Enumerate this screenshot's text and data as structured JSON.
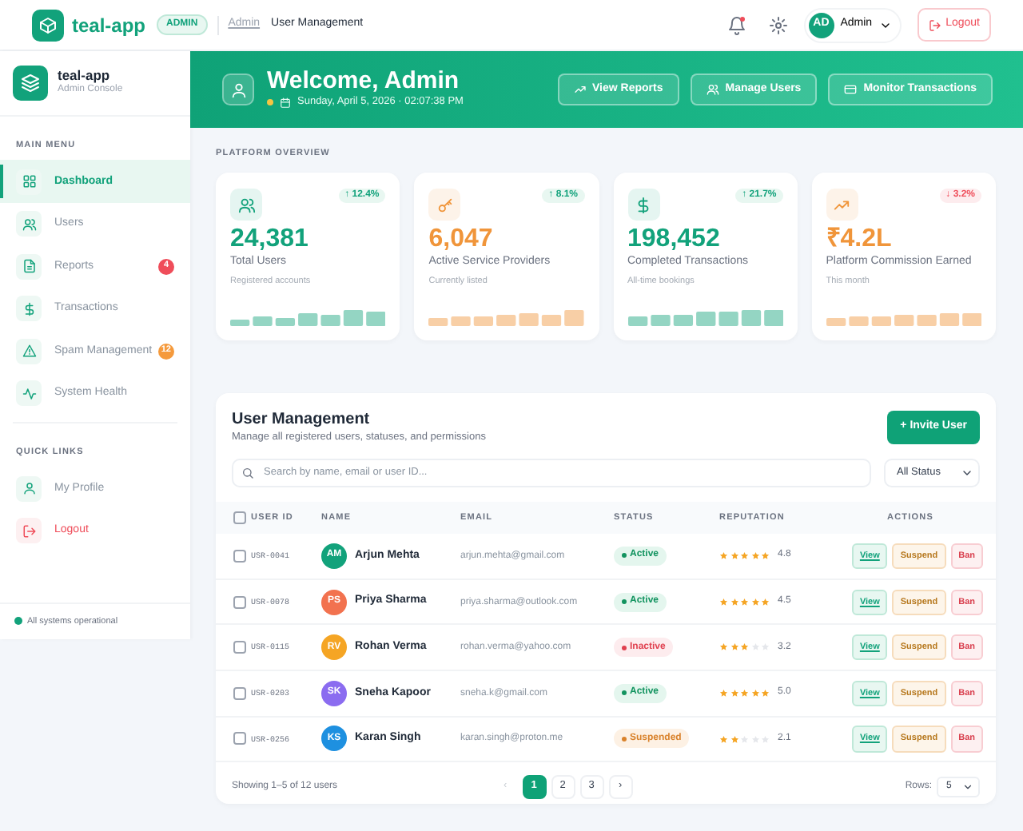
{
  "topbar": {
    "brand": "teal-app",
    "role_badge": "ADMIN",
    "breadcrumb": [
      "Admin",
      "User Management"
    ],
    "has_unread": true,
    "user": {
      "initials": "AD",
      "name": "Admin"
    },
    "logout": "Logout"
  },
  "sidebar": {
    "brand": "teal-app",
    "subtitle": "Admin Console",
    "sections": [
      {
        "title": "MAIN MENU",
        "items": [
          {
            "label": "Dashboard",
            "kind": "normal",
            "selected": true
          },
          {
            "label": "Users",
            "kind": "normal",
            "selected": false
          },
          {
            "label": "Reports",
            "kind": "normal",
            "selected": false,
            "badge": "4",
            "color": "#ef4d5a"
          },
          {
            "label": "Transactions",
            "kind": "normal",
            "selected": false
          },
          {
            "label": "Spam Management",
            "kind": "normal",
            "selected": false,
            "badge": "12",
            "color": "#f59a3c"
          },
          {
            "label": "System Health",
            "kind": "normal",
            "selected": false
          }
        ]
      },
      {
        "title": "QUICK LINKS",
        "items": [
          {
            "label": "My Profile",
            "kind": "normal",
            "selected": false
          },
          {
            "label": "Logout",
            "kind": "danger",
            "selected": false
          }
        ]
      }
    ],
    "status": "All systems operational"
  },
  "hero": {
    "title": "Welcome, Admin",
    "date": "Sunday, April 5, 2026 · 02:07:38 PM",
    "buttons": [
      "View Reports",
      "Manage Users",
      "Monitor Transactions"
    ]
  },
  "overview": {
    "title": "PLATFORM OVERVIEW",
    "cards": [
      {
        "value": "24,381",
        "label": "Total Users",
        "note": "Registered accounts",
        "change": "↑ 12.4%",
        "positive": true,
        "color": "#12a27b"
      },
      {
        "value": "6,047",
        "label": "Active Service Providers",
        "note": "Currently listed",
        "change": "↑ 8.1%",
        "positive": true,
        "color": "#f0953a"
      },
      {
        "value": "198,452",
        "label": "Completed Transactions",
        "note": "All-time bookings",
        "change": "↑ 21.7%",
        "positive": true,
        "color": "#12a27b"
      },
      {
        "value": "₹4.2L",
        "label": "Platform Commission Earned",
        "note": "This month",
        "change": "↓ 3.2%",
        "positive": false,
        "color": "#f0953a"
      }
    ]
  },
  "users": {
    "title": "User Management",
    "subtitle": "Manage all registered users, statuses, and permissions",
    "invite": "+ Invite User",
    "search": {
      "placeholder": "Search by name, email or user ID..."
    },
    "filter": "All Status",
    "select_all": {
      "checked": false
    },
    "columns": [
      "USER ID",
      "NAME",
      "EMAIL",
      "STATUS",
      "REPUTATION",
      "ACTIONS"
    ],
    "rows": [
      {
        "id": "USR-0041",
        "initials": "AM",
        "name": "Arjun Mehta",
        "email": "arjun.mehta@gmail.com",
        "status": "Active",
        "kind": "active",
        "stars": 5,
        "rating": "4.8",
        "color": "#12a27b",
        "checked": false,
        "actions": [
          "View",
          "Suspend",
          "Ban"
        ]
      },
      {
        "id": "USR-0078",
        "initials": "PS",
        "name": "Priya Sharma",
        "email": "priya.sharma@outlook.com",
        "status": "Active",
        "kind": "active",
        "stars": 5,
        "rating": "4.5",
        "color": "#f2724f",
        "checked": false,
        "actions": [
          "View",
          "Suspend",
          "Ban"
        ]
      },
      {
        "id": "USR-0115",
        "initials": "RV",
        "name": "Rohan Verma",
        "email": "rohan.verma@yahoo.com",
        "status": "Inactive",
        "kind": "inactive",
        "stars": 3,
        "rating": "3.2",
        "color": "#f5a524",
        "checked": false,
        "actions": [
          "View",
          "Suspend",
          "Ban"
        ]
      },
      {
        "id": "USR-0203",
        "initials": "SK",
        "name": "Sneha Kapoor",
        "email": "sneha.k@gmail.com",
        "status": "Active",
        "kind": "active",
        "stars": 5,
        "rating": "5.0",
        "color": "#8b6cf0",
        "checked": false,
        "actions": [
          "View",
          "Suspend",
          "Ban"
        ]
      },
      {
        "id": "USR-0256",
        "initials": "KS",
        "name": "Karan Singh",
        "email": "karan.singh@proton.me",
        "status": "Suspended",
        "kind": "suspended",
        "stars": 2,
        "rating": "2.1",
        "color": "#1e90e0",
        "checked": false,
        "actions": [
          "View",
          "Suspend",
          "Ban"
        ]
      }
    ],
    "showing": "Showing 1–5 of 12 users",
    "pager": {
      "prev": {
        "label": "‹",
        "disabled": true
      },
      "pages": [
        {
          "label": "1",
          "selected": true
        },
        {
          "label": "2",
          "selected": false
        },
        {
          "label": "3",
          "selected": false
        }
      ],
      "next": {
        "label": "›",
        "disabled": false
      }
    },
    "rows_label": "Rows:",
    "rows_value": "5"
  }
}
